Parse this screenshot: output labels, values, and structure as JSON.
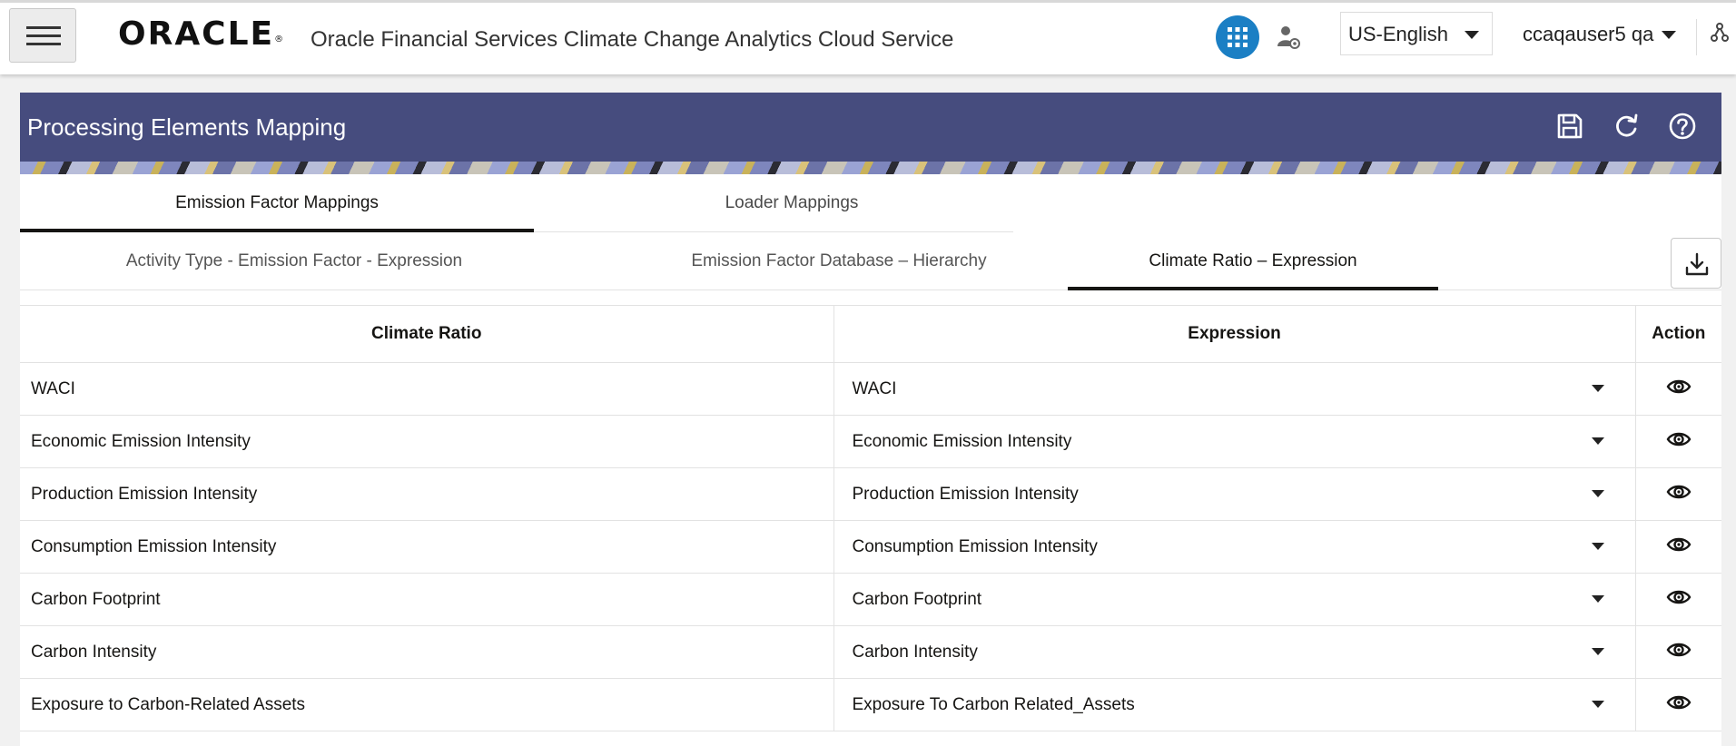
{
  "header": {
    "logo_text": "ORACLE",
    "app_title": "Oracle Financial Services Climate Change Analytics Cloud Service",
    "language": "US-English",
    "user": "ccaqauser5 qa",
    "icons": [
      "hamburger-menu-icon",
      "apps-grid-icon",
      "user-admin-icon",
      "network-icon"
    ],
    "accent_color": "#1b7fc4"
  },
  "page": {
    "title": "Processing Elements Mapping",
    "banner_color": "#464c7e",
    "header_icons": [
      "save-icon",
      "refresh-icon",
      "help-icon"
    ]
  },
  "tabs_primary": [
    {
      "label": "Emission Factor Mappings",
      "active": true
    },
    {
      "label": "Loader Mappings",
      "active": false
    }
  ],
  "tabs_secondary": [
    {
      "label": "Activity Type - Emission Factor - Expression",
      "active": false
    },
    {
      "label": "Emission Factor Database – Hierarchy",
      "active": false
    },
    {
      "label": "Climate Ratio – Expression",
      "active": true
    }
  ],
  "table": {
    "columns": [
      "Climate Ratio",
      "Expression",
      "Action"
    ],
    "rows": [
      {
        "ratio": "WACI",
        "expression": "WACI"
      },
      {
        "ratio": "Economic Emission Intensity",
        "expression": "Economic Emission Intensity"
      },
      {
        "ratio": "Production Emission Intensity",
        "expression": "Production Emission Intensity"
      },
      {
        "ratio": "Consumption Emission Intensity",
        "expression": "Consumption Emission Intensity"
      },
      {
        "ratio": "Carbon Footprint",
        "expression": "Carbon Footprint"
      },
      {
        "ratio": "Carbon Intensity",
        "expression": "Carbon Intensity"
      },
      {
        "ratio": "Exposure to Carbon-Related Assets",
        "expression": "Exposure To Carbon Related_Assets"
      }
    ]
  }
}
